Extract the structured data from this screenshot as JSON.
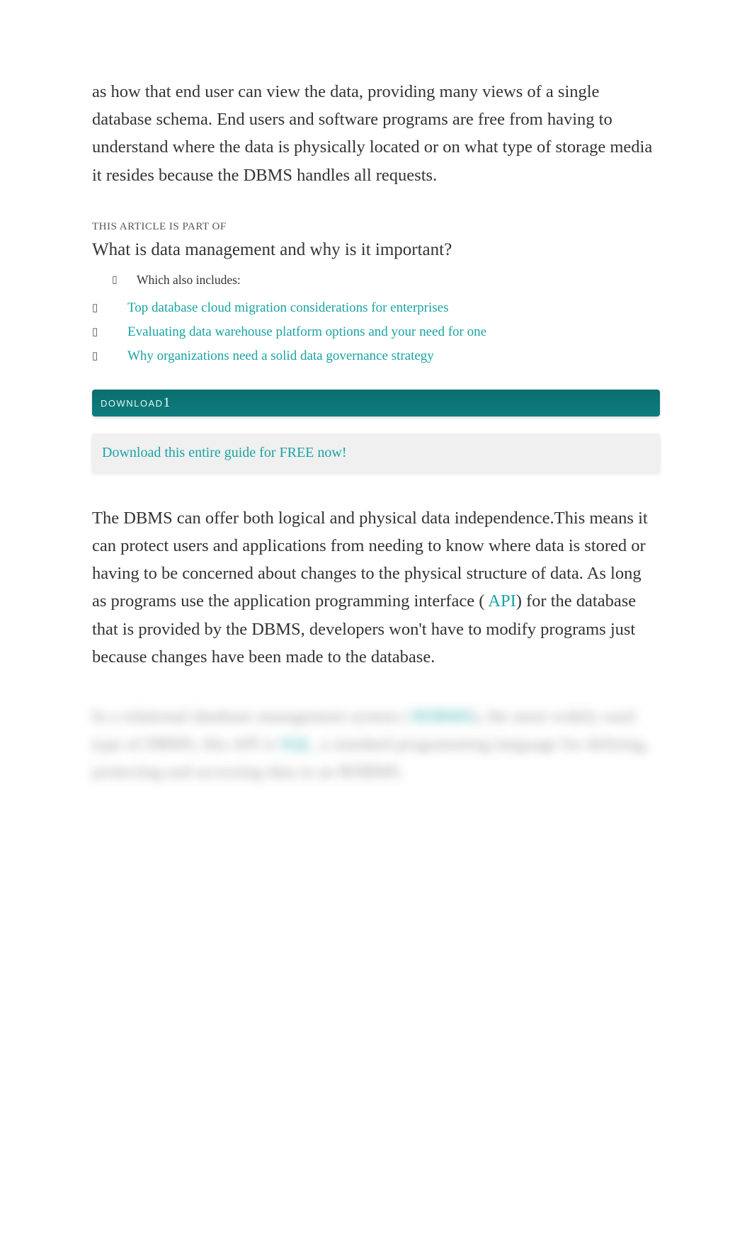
{
  "intro_paragraph": "as how that end user can view the data, providing many views of a single database schema. End users and software programs are free from having to understand where the data is physically located or on what type of storage media it resides because the DBMS handles all requests.",
  "partof": {
    "label": "THIS ARTICLE IS PART OF",
    "title": "What is data management and why is it important?",
    "which_includes": "Which also includes:",
    "items": [
      "Top database cloud migration considerations for enterprises",
      "Evaluating data warehouse platform options and your need for one",
      "Why organizations need a solid data governance strategy"
    ]
  },
  "download": {
    "label": "DOWNLOAD",
    "count": "1",
    "cta": "Download this entire guide for FREE now!"
  },
  "body_paragraph": {
    "pre": "The DBMS can offer both logical and physical data independence.This means it can protect users and applications from needing to know where data is stored or having to be concerned about changes to the physical structure of data. As long as programs use the application programming interface (",
    "api_link": "API",
    "post": ") for the database that is provided by the DBMS, developers won't have to modify programs just because changes have been made to the database."
  },
  "locked_paragraph": {
    "seg1": "In a relational database management system (",
    "rdbms_link": "RDBMS",
    "seg2": "), the most widely used type of DBMS, this API is ",
    "sql_link": "SQL",
    "seg3": ", a standard programming language for defining, protecting and accessing data in an RDBMS."
  }
}
